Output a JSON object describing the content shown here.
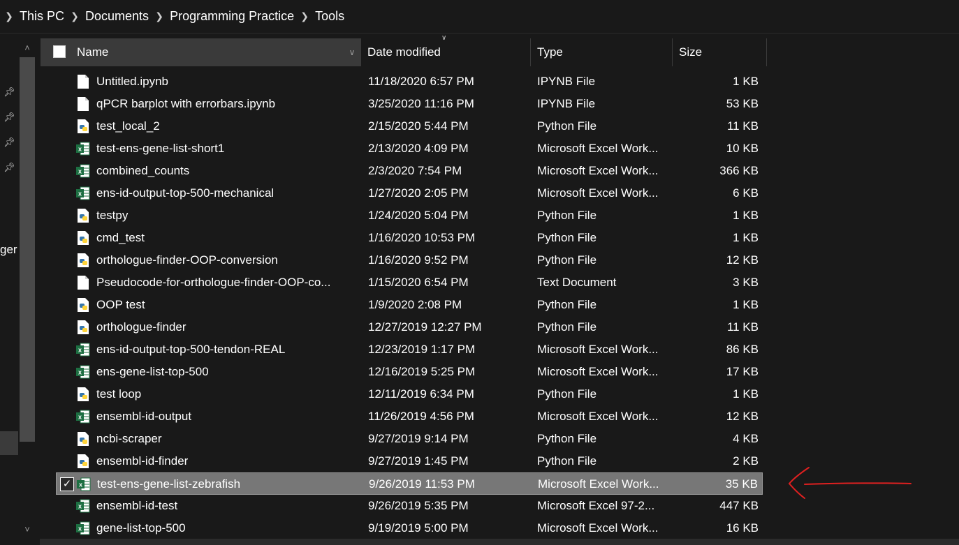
{
  "breadcrumb": [
    "This PC",
    "Documents",
    "Programming Practice",
    "Tools"
  ],
  "nav": {
    "partial_label": "ger"
  },
  "columns": {
    "name": "Name",
    "date": "Date modified",
    "type": "Type",
    "size": "Size"
  },
  "colors": {
    "background": "#191919",
    "header": "#3a3a3a",
    "selected_row": "#777777",
    "excel": "#1d6f42",
    "annotation": "#e02020"
  },
  "files": [
    {
      "name": "Untitled.ipynb",
      "date": "11/18/2020 6:57 PM",
      "type": "IPYNB File",
      "size": "1 KB",
      "icon": "document-icon"
    },
    {
      "name": "qPCR barplot with errorbars.ipynb",
      "date": "3/25/2020 11:16 PM",
      "type": "IPYNB File",
      "size": "53 KB",
      "icon": "document-icon"
    },
    {
      "name": "test_local_2",
      "date": "2/15/2020 5:44 PM",
      "type": "Python File",
      "size": "11 KB",
      "icon": "python-file-icon"
    },
    {
      "name": "test-ens-gene-list-short1",
      "date": "2/13/2020 4:09 PM",
      "type": "Microsoft Excel Work...",
      "size": "10 KB",
      "icon": "excel-file-icon"
    },
    {
      "name": "combined_counts",
      "date": "2/3/2020 7:54 PM",
      "type": "Microsoft Excel Work...",
      "size": "366 KB",
      "icon": "excel-file-icon"
    },
    {
      "name": "ens-id-output-top-500-mechanical",
      "date": "1/27/2020 2:05 PM",
      "type": "Microsoft Excel Work...",
      "size": "6 KB",
      "icon": "excel-file-icon"
    },
    {
      "name": "testpy",
      "date": "1/24/2020 5:04 PM",
      "type": "Python File",
      "size": "1 KB",
      "icon": "python-file-icon"
    },
    {
      "name": "cmd_test",
      "date": "1/16/2020 10:53 PM",
      "type": "Python File",
      "size": "1 KB",
      "icon": "python-file-icon"
    },
    {
      "name": "orthologue-finder-OOP-conversion",
      "date": "1/16/2020 9:52 PM",
      "type": "Python File",
      "size": "12 KB",
      "icon": "python-file-icon"
    },
    {
      "name": "Pseudocode-for-orthologue-finder-OOP-co...",
      "date": "1/15/2020 6:54 PM",
      "type": "Text Document",
      "size": "3 KB",
      "icon": "document-icon"
    },
    {
      "name": "OOP test",
      "date": "1/9/2020 2:08 PM",
      "type": "Python File",
      "size": "1 KB",
      "icon": "python-file-icon"
    },
    {
      "name": "orthologue-finder",
      "date": "12/27/2019 12:27 PM",
      "type": "Python File",
      "size": "11 KB",
      "icon": "python-file-icon"
    },
    {
      "name": "ens-id-output-top-500-tendon-REAL",
      "date": "12/23/2019 1:17 PM",
      "type": "Microsoft Excel Work...",
      "size": "86 KB",
      "icon": "excel-file-icon"
    },
    {
      "name": "ens-gene-list-top-500",
      "date": "12/16/2019 5:25 PM",
      "type": "Microsoft Excel Work...",
      "size": "17 KB",
      "icon": "excel-file-icon"
    },
    {
      "name": "test loop",
      "date": "12/11/2019 6:34 PM",
      "type": "Python File",
      "size": "1 KB",
      "icon": "python-file-icon"
    },
    {
      "name": "ensembl-id-output",
      "date": "11/26/2019 4:56 PM",
      "type": "Microsoft Excel Work...",
      "size": "12 KB",
      "icon": "excel-file-icon"
    },
    {
      "name": "ncbi-scraper",
      "date": "9/27/2019 9:14 PM",
      "type": "Python File",
      "size": "4 KB",
      "icon": "python-file-icon"
    },
    {
      "name": "ensembl-id-finder",
      "date": "9/27/2019 1:45 PM",
      "type": "Python File",
      "size": "2 KB",
      "icon": "python-file-icon"
    },
    {
      "name": "test-ens-gene-list-zebrafish",
      "date": "9/26/2019 11:53 PM",
      "type": "Microsoft Excel Work...",
      "size": "35 KB",
      "icon": "excel-file-icon",
      "selected": true
    },
    {
      "name": "ensembl-id-test",
      "date": "9/26/2019 5:35 PM",
      "type": "Microsoft Excel 97-2...",
      "size": "447 KB",
      "icon": "excel-file-icon"
    },
    {
      "name": "gene-list-top-500",
      "date": "9/19/2019 5:00 PM",
      "type": "Microsoft Excel Work...",
      "size": "16 KB",
      "icon": "excel-file-icon"
    }
  ]
}
